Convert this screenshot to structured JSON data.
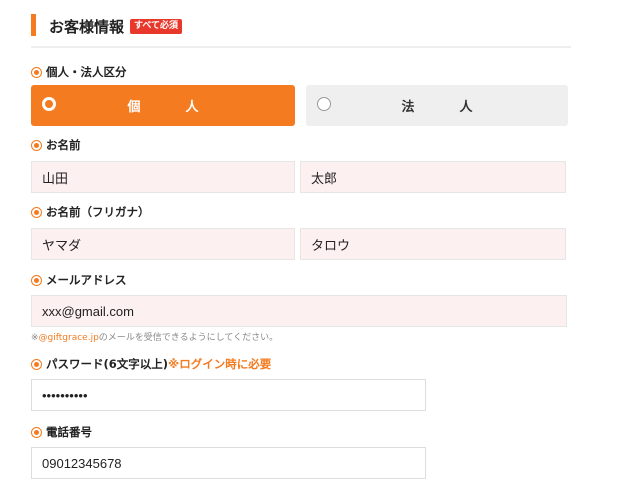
{
  "section": {
    "title": "お客様情報",
    "badge": "すべて必須"
  },
  "customer_type": {
    "label": "個人・法人区分",
    "options": [
      {
        "label": "個　人",
        "selected": true
      },
      {
        "label": "法　人",
        "selected": false
      }
    ]
  },
  "name": {
    "label": "お名前",
    "last": "山田",
    "first": "太郎"
  },
  "kana": {
    "label": "お名前（フリガナ）",
    "last": "ヤマダ",
    "first": "タロウ"
  },
  "email": {
    "label": "メールアドレス",
    "value": "xxx@gmail.com",
    "note_prefix": "※",
    "note_domain": "@giftgrace.jp",
    "note_suffix": "のメールを受信できるようにしてください。"
  },
  "password": {
    "label": "パスワード(6文字以上)",
    "note": "※ログイン時に必要",
    "value": "••••••••••"
  },
  "phone": {
    "label": "電話番号",
    "value": "09012345678"
  },
  "colors": {
    "accent": "#f47b20",
    "badge": "#e8382c",
    "input_bg": "#fdf0f0"
  }
}
